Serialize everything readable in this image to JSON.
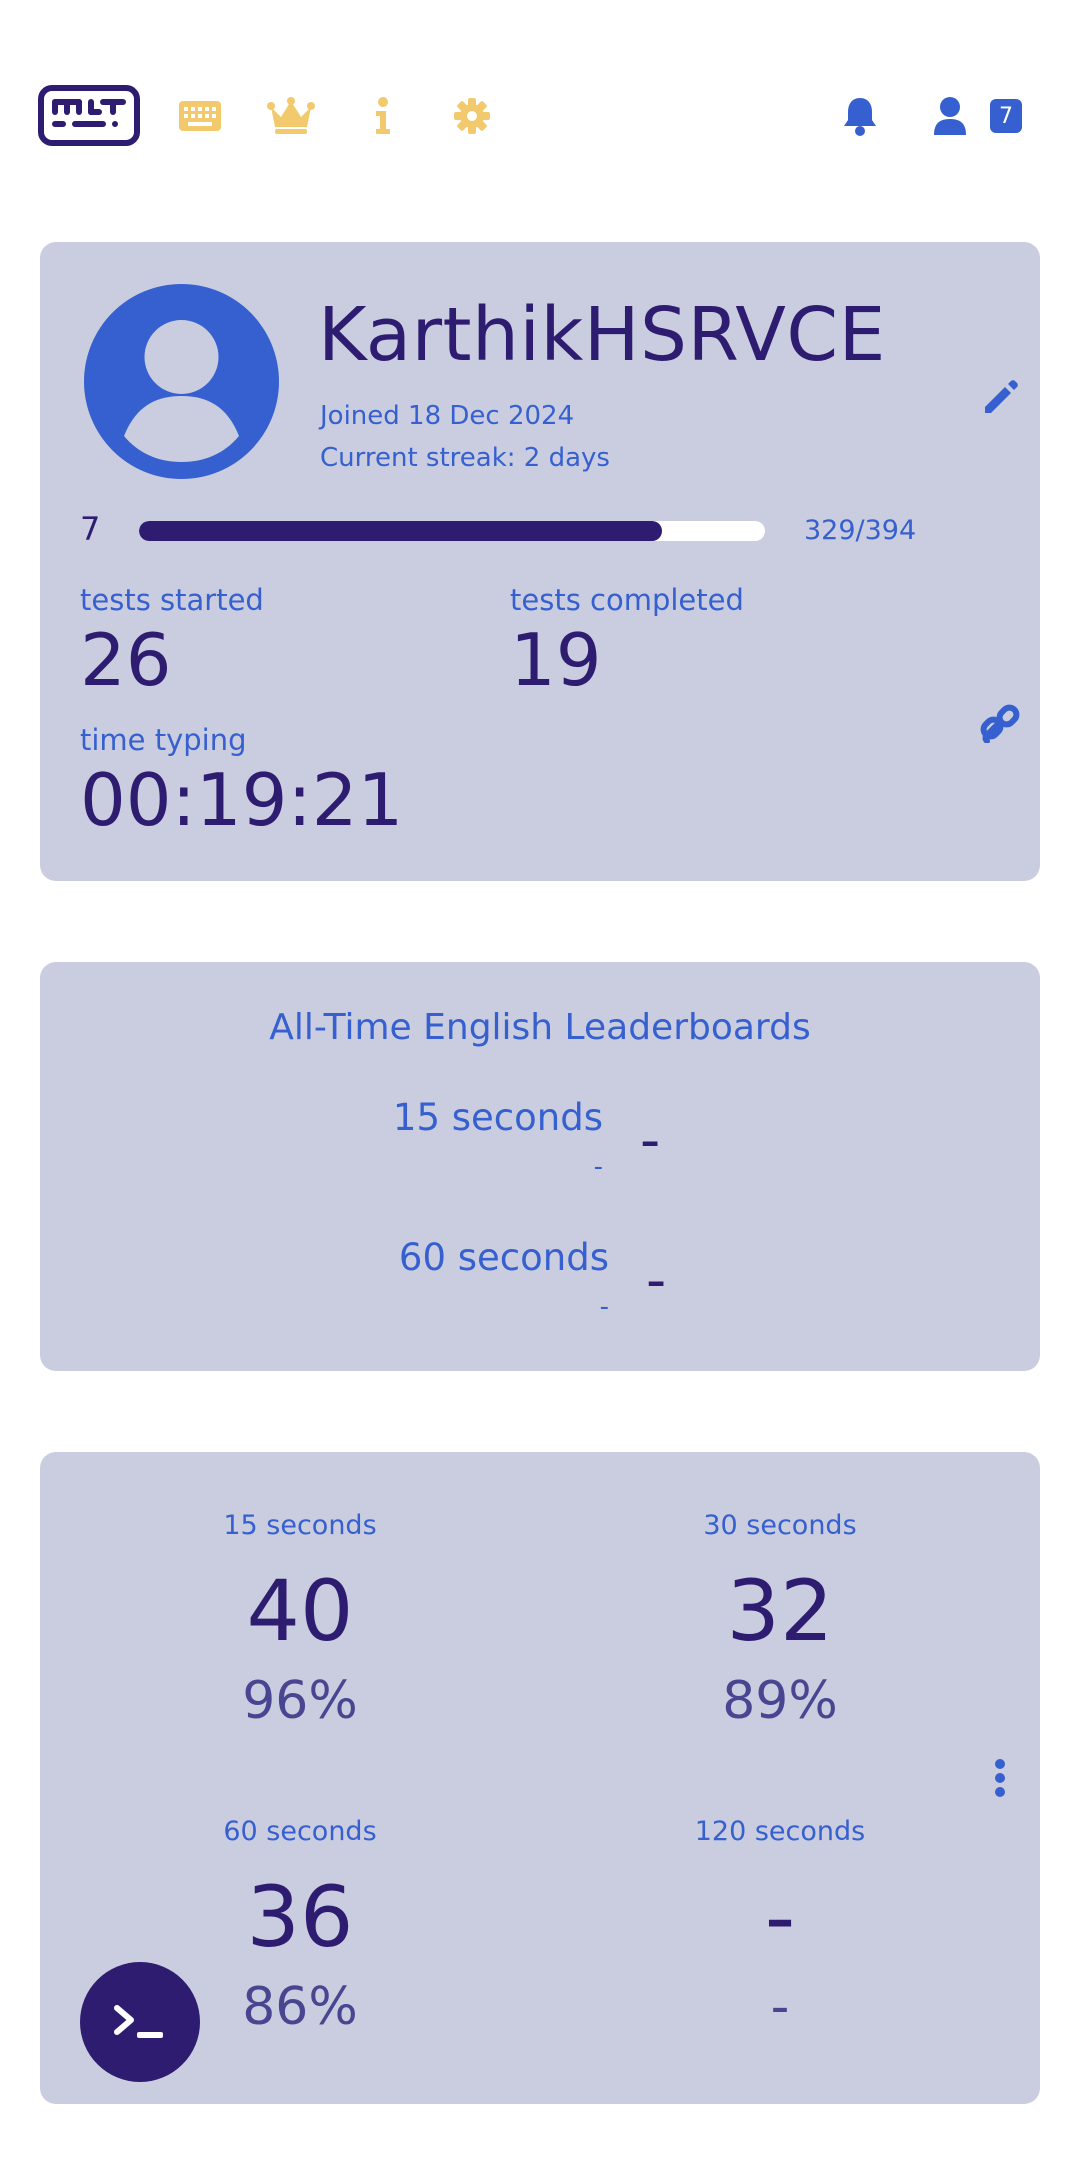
{
  "nav": {
    "items": [
      {
        "icon": "keyboard-icon"
      },
      {
        "icon": "crown-icon"
      },
      {
        "icon": "info-icon"
      },
      {
        "icon": "gear-icon"
      }
    ],
    "notification_icon": "bell-icon",
    "account_icon": "user-icon",
    "account_level": "7",
    "accent_color": "#f2c96d",
    "primary_color": "#3660cf"
  },
  "profile": {
    "username": "KarthikHSRVCE",
    "joined": "Joined 18 Dec 2024",
    "streak": "Current streak: 2 days",
    "level": "7",
    "xp_text": "329/394",
    "xp_progress": 0.835,
    "tests_started_label": "tests started",
    "tests_started": "26",
    "tests_completed_label": "tests completed",
    "tests_completed": "19",
    "time_typing_label": "time typing",
    "time_typing": "00:19:21"
  },
  "leaderboards": {
    "title": "All-Time English Leaderboards",
    "entries": [
      {
        "mode": "15 seconds",
        "sub": "-",
        "rank": "-"
      },
      {
        "mode": "60 seconds",
        "sub": "-",
        "rank": "-"
      }
    ]
  },
  "personal_bests": [
    {
      "mode": "15 seconds",
      "wpm": "40",
      "acc": "96%"
    },
    {
      "mode": "30 seconds",
      "wpm": "32",
      "acc": "89%"
    },
    {
      "mode": "60 seconds",
      "wpm": "36",
      "acc": "86%"
    },
    {
      "mode": "120 seconds",
      "wpm": "-",
      "acc": "-"
    }
  ]
}
